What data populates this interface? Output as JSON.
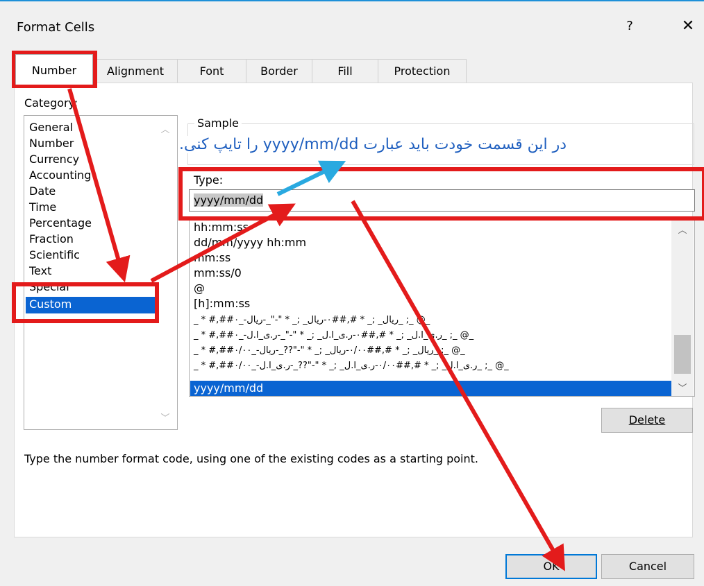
{
  "dialog": {
    "title": "Format Cells",
    "help_label": "?",
    "close_label": "✕"
  },
  "tabs": [
    {
      "label": "Number"
    },
    {
      "label": "Alignment"
    },
    {
      "label": "Font"
    },
    {
      "label": "Border"
    },
    {
      "label": "Fill"
    },
    {
      "label": "Protection"
    }
  ],
  "category": {
    "label": "Category:",
    "items": [
      "General",
      "Number",
      "Currency",
      "Accounting",
      "Date",
      "Time",
      "Percentage",
      "Fraction",
      "Scientific",
      "Text",
      "Special",
      "Custom"
    ],
    "selected": "Custom"
  },
  "sample": {
    "legend": "Sample"
  },
  "type": {
    "label": "Type:",
    "value": "yyyy/mm/dd"
  },
  "formats": {
    "items": [
      "hh:mm:ss",
      "dd/mm/yyyy hh:mm",
      "mm:ss",
      "mm:ss/0",
      "@",
      "[h]:mm:ss",
      "_ * #,##۰_-ریال_ ;_ * #,##۰-ریال_ ;_ * \"-\"_-ریال_ ;_ @_",
      "_ * #,##۰_-ر.ی_ا.ل_ ;_ * #,##۰-ر.ی_ا.ل_ ;_ * \"-\"_-ر.ی_ا.ل_ ;_ @_",
      "_ * #,##۰/۰۰_-ریال_ ;_ * #,##۰/۰۰-ریال_ ;_ * \"-\"??_-ریال_ ;_ @_",
      "_ * #,##۰/۰۰_-ر.ی_ا.ل_ ;_ * #,##۰/۰۰-ر.ی_ا.ل_ ;_ * \"-\"??_-ر.ی_ا.ل_ ;_ @_",
      "yyyy/mm/dd"
    ],
    "selected": "yyyy/mm/dd"
  },
  "buttons": {
    "delete_label": "Delete",
    "ok_label": "OK",
    "cancel_label": "Cancel"
  },
  "hint": "Type the number format code, using one of the existing codes as a starting point.",
  "annotation": "در این قسمت خودت باید عبارت yyyy/mm/dd را تایپ کنی.",
  "colors": {
    "selection": "#0a64d2",
    "annotation_red": "#e31b1b",
    "annotation_blue": "#29a9e0",
    "ok_border": "#0078d7"
  }
}
